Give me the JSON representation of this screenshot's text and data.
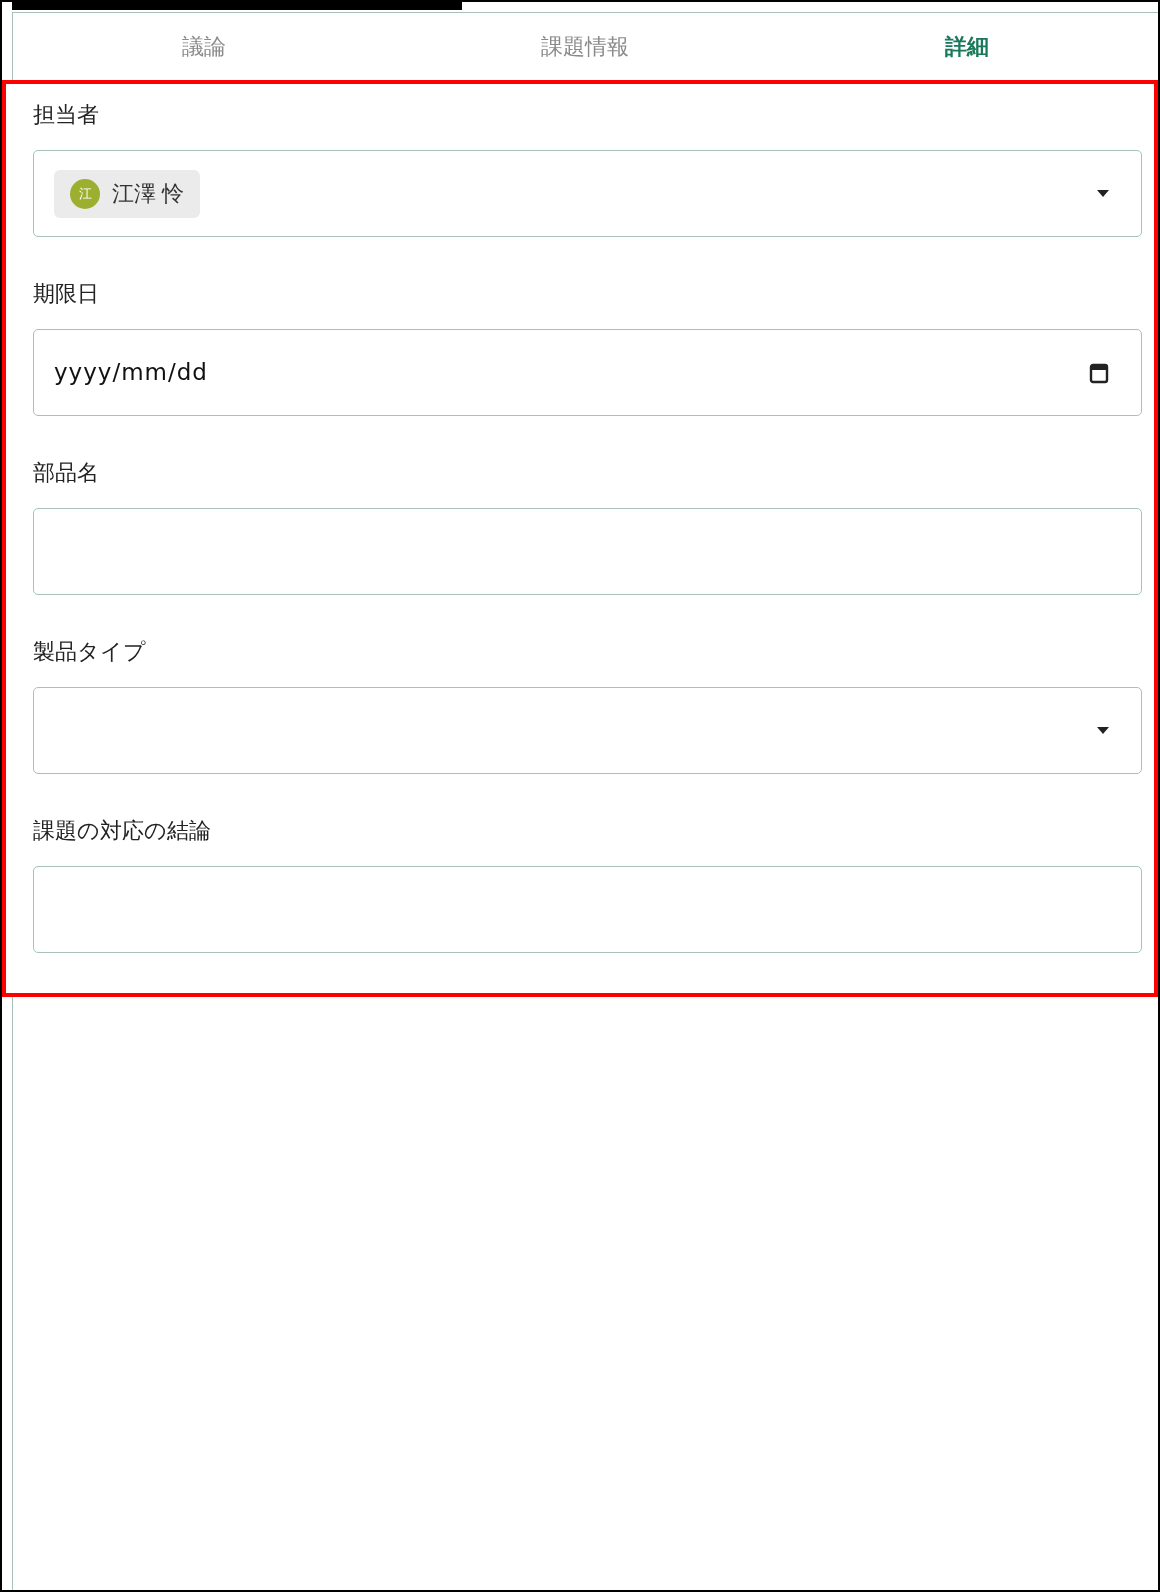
{
  "tabs": [
    {
      "label": "議論",
      "selected": false
    },
    {
      "label": "課題情報",
      "selected": false
    },
    {
      "label": "詳細",
      "selected": true
    }
  ],
  "fields": [
    {
      "label": "担当者",
      "kind": "select",
      "chips": [
        {
          "initial": "江",
          "name": "江澤 怜",
          "color": "#9caf2e"
        }
      ]
    },
    {
      "label": "期限日",
      "kind": "date",
      "placeholder": "yyyy/mm/dd"
    },
    {
      "label": "部品名",
      "kind": "text"
    },
    {
      "label": "製品タイプ",
      "kind": "select"
    },
    {
      "label": "課題の対応の結論",
      "kind": "text"
    }
  ]
}
